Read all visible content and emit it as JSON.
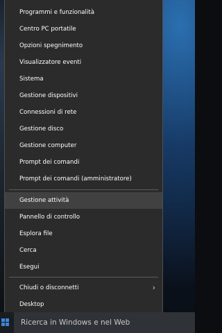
{
  "menu": {
    "items": [
      {
        "label": "Programmi e funzionalità"
      },
      {
        "label": "Centro PC portatile"
      },
      {
        "label": "Opzioni spegnimento"
      },
      {
        "label": "Visualizzatore eventi"
      },
      {
        "label": "Sistema"
      },
      {
        "label": "Gestione dispositivi"
      },
      {
        "label": "Connessioni di rete"
      },
      {
        "label": "Gestione disco"
      },
      {
        "label": "Gestione computer"
      },
      {
        "label": "Prompt dei comandi"
      },
      {
        "label": "Prompt dei comandi (amministratore)"
      },
      {
        "label": "Gestione attività"
      },
      {
        "label": "Pannello di controllo"
      },
      {
        "label": "Esplora file"
      },
      {
        "label": "Cerca"
      },
      {
        "label": "Esegui"
      },
      {
        "label": "Chiudi o disconnetti"
      },
      {
        "label": "Desktop"
      }
    ],
    "submenu_icon": "chevron-right-icon",
    "submenu_glyph": "›",
    "highlighted_item": "Gestione attività"
  },
  "taskbar": {
    "start_icon": "windows-logo-icon",
    "search_placeholder": "Ricerca in Windows e nel Web"
  },
  "colors": {
    "menu_background": "#2b2b2b",
    "highlight": "#414141",
    "separator": "#5c5c5c",
    "text": "#ffffff",
    "taskbar": "#191c21",
    "search_box": "#2f3236",
    "accent": "#3a86d8"
  }
}
